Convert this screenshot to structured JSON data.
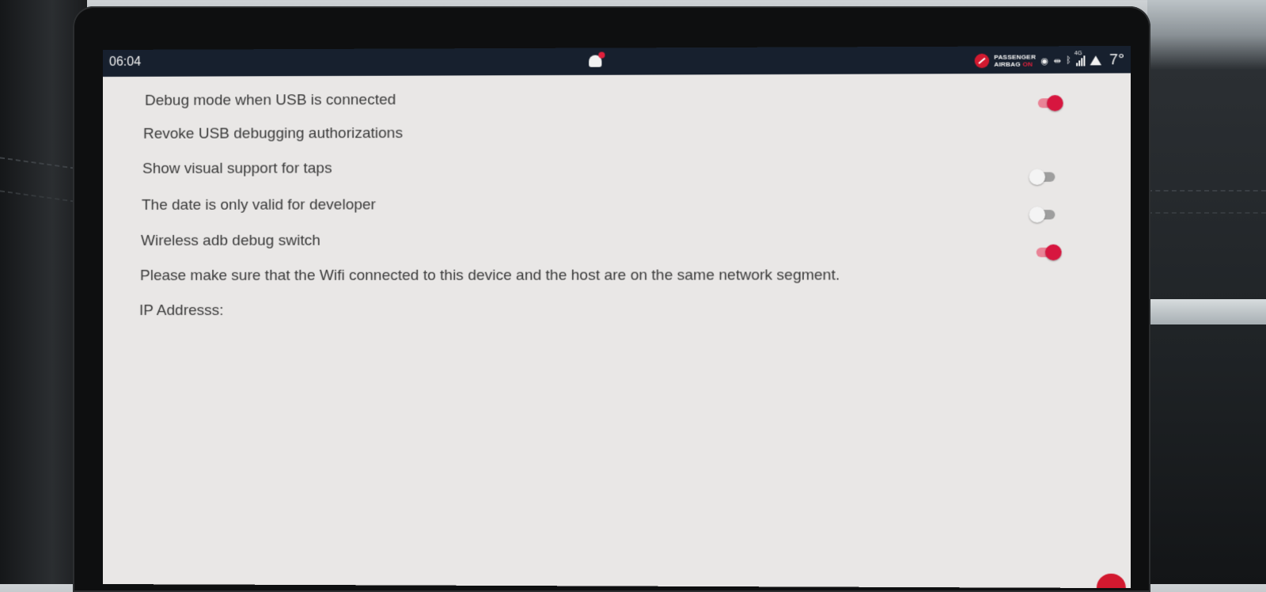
{
  "statusbar": {
    "time": "06:04",
    "airbag_line1": "PASSENGER",
    "airbag_line2": "AIRBAG",
    "airbag_state": "ON",
    "network_label": "4G",
    "temperature": "7°",
    "icons": [
      "notification-bell-icon",
      "airbag-icon",
      "location-icon",
      "usb-icon",
      "bluetooth-icon",
      "signal-icon",
      "warning-icon"
    ],
    "colors": {
      "bar_bg": "#17202e",
      "alert_red": "#e0203c"
    }
  },
  "settings": {
    "debug_usb_label": "Debug mode when USB is connected",
    "debug_usb_on": true,
    "revoke_label": "Revoke USB debugging authorizations",
    "taps_label": "Show visual support for taps",
    "taps_on": false,
    "date_label": "The date is only valid for developer",
    "date_on": false,
    "wireless_label": "Wireless adb debug switch",
    "wireless_on": true,
    "note_text": "Please make sure that the Wifi connected to this device and the host are on the same network segment.",
    "ip_label": "IP Addresss:"
  },
  "colors": {
    "accent": "#d7163f",
    "screen_bg": "#e9e7e6"
  }
}
